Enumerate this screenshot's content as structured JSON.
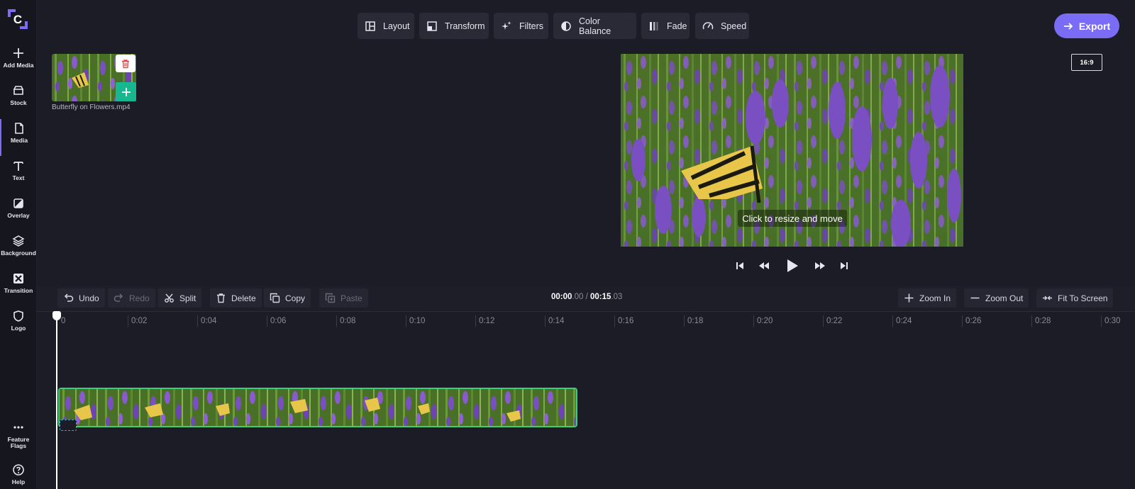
{
  "sidebar": {
    "logo": "C",
    "items": [
      {
        "label": "Add Media",
        "icon": "plus-icon"
      },
      {
        "label": "Stock",
        "icon": "stock-icon"
      },
      {
        "label": "Media",
        "icon": "file-icon"
      },
      {
        "label": "Text",
        "icon": "text-icon"
      },
      {
        "label": "Overlay",
        "icon": "overlay-icon"
      },
      {
        "label": "Background",
        "icon": "layers-icon"
      },
      {
        "label": "Transition",
        "icon": "transition-icon"
      },
      {
        "label": "Logo",
        "icon": "shield-icon"
      }
    ],
    "bottom": [
      {
        "label_line1": "Feature",
        "label_line2": "Flags",
        "icon": "more-icon"
      },
      {
        "label": "Help",
        "icon": "help-icon"
      }
    ]
  },
  "toolbar": {
    "layout": "Layout",
    "transform": "Transform",
    "filters": "Filters",
    "color_balance": "Color Balance",
    "fade": "Fade",
    "speed": "Speed"
  },
  "export_label": "Export",
  "aspect_ratio": "16:9",
  "media": {
    "file_name": "Butterfly on Flowers.mp4"
  },
  "preview": {
    "hint": "Click to resize and move"
  },
  "timeline_toolbar": {
    "undo": "Undo",
    "redo": "Redo",
    "split": "Split",
    "delete": "Delete",
    "copy": "Copy",
    "paste": "Paste",
    "zoom_in": "Zoom In",
    "zoom_out": "Zoom Out",
    "fit": "Fit To Screen"
  },
  "timecode": {
    "current_main": "00:00",
    "current_frac": ".00",
    "separator": " / ",
    "total_main": "00:15",
    "total_frac": ".03"
  },
  "ruler": [
    "0",
    "0:02",
    "0:04",
    "0:06",
    "0:08",
    "0:10",
    "0:12",
    "0:14",
    "0:16",
    "0:18",
    "0:20",
    "0:22",
    "0:24",
    "0:26",
    "0:28",
    "0:30"
  ],
  "colors": {
    "accent": "#7b6cf6",
    "clip_border": "#3ccf7a",
    "add_button": "#17b890",
    "delete_icon": "#e24a4a"
  }
}
